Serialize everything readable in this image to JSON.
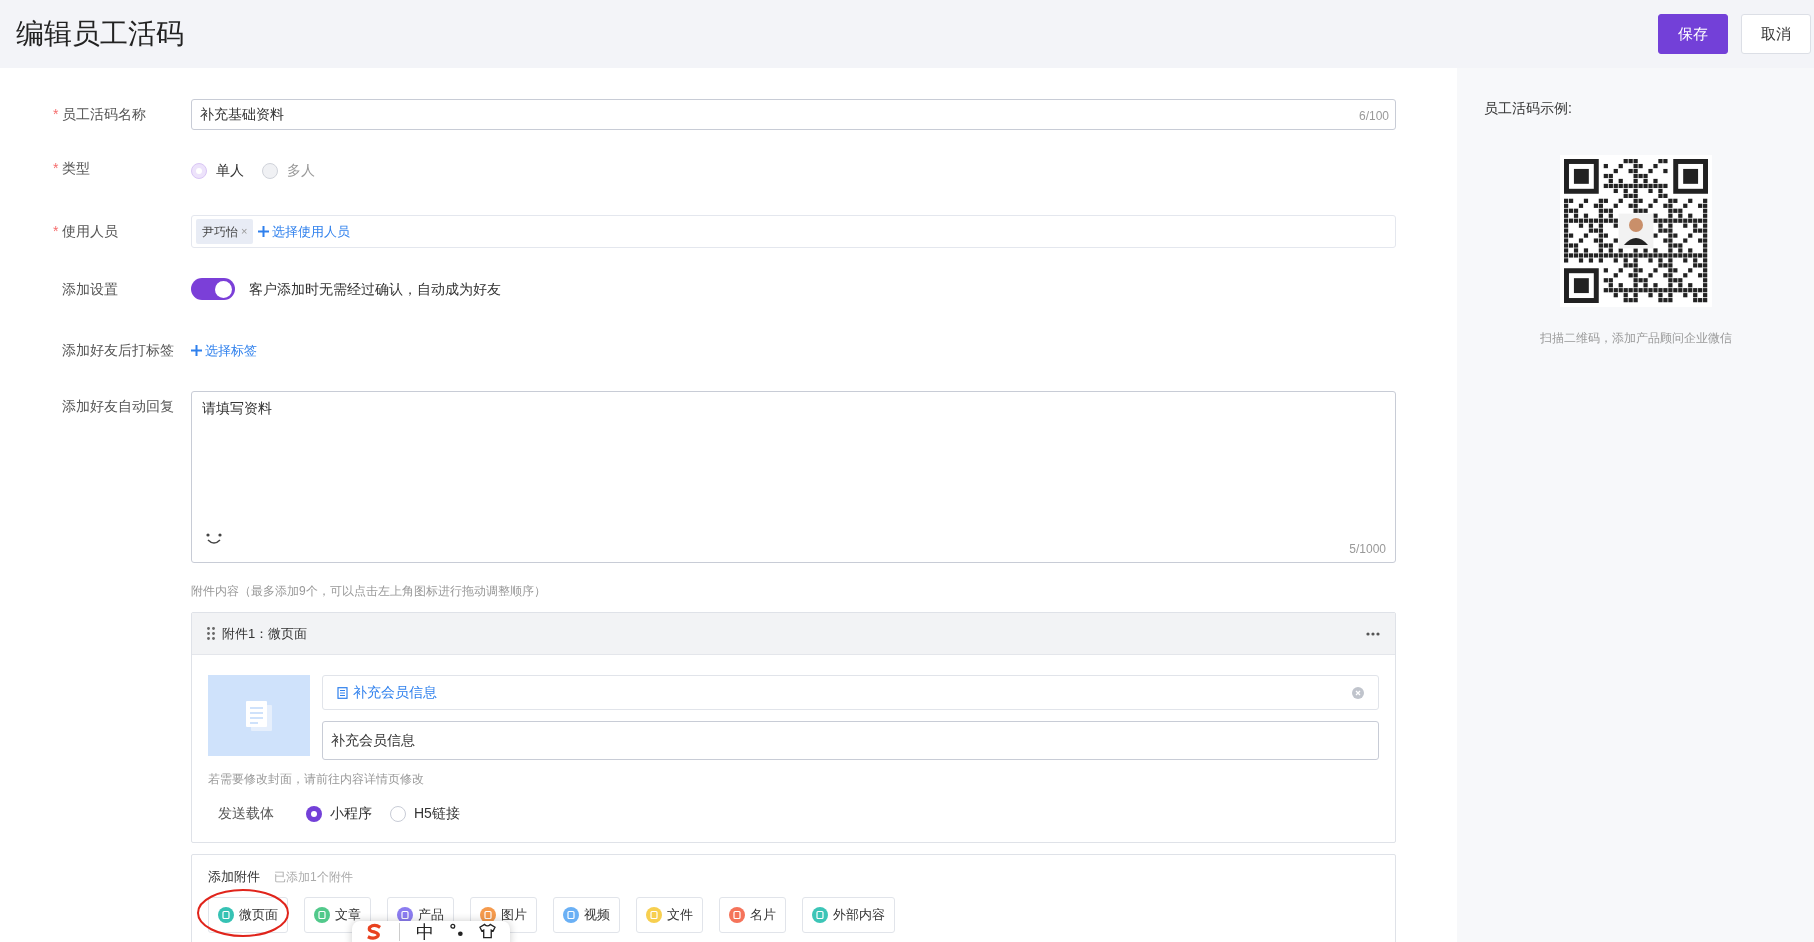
{
  "header": {
    "title": "编辑员工活码",
    "buttons": [
      {
        "label": "保存",
        "kind": "primary"
      },
      {
        "label": "取消",
        "kind": "default"
      }
    ]
  },
  "name_field": {
    "label": "员工活码名称",
    "required_mark": "*",
    "value": "补充基础资料",
    "counter": "6/100"
  },
  "type_field": {
    "label": "类型",
    "required_mark": "*",
    "disabled": true,
    "options": [
      {
        "label": "单人",
        "selected": true
      },
      {
        "label": "多人",
        "selected": false
      }
    ]
  },
  "users_field": {
    "label": "使用人员",
    "required_mark": "*",
    "tags": [
      {
        "label": "尹巧怡",
        "remove": "×"
      }
    ],
    "add_link": "选择使用人员"
  },
  "add_setting": {
    "label": "添加设置",
    "on": true,
    "text": "客户添加时无需经过确认，自动成为好友"
  },
  "tag_setting": {
    "label": "添加好友后打标签",
    "add_link": "选择标签"
  },
  "auto_reply": {
    "label": "添加好友自动回复",
    "value": "请填写资料",
    "counter": "5/1000",
    "hint": "附件内容（最多添加9个，可以点击左上角图标进行拖动调整顺序）"
  },
  "attachments": [
    {
      "title": "附件1：微页面",
      "link_title": "补充会员信息",
      "value": "补充会员信息",
      "note": "若需要修改封面，请前往内容详情页修改",
      "carrier_label": "发送载体",
      "carriers": [
        {
          "label": "小程序",
          "selected": true
        },
        {
          "label": "H5链接",
          "selected": false
        }
      ]
    }
  ],
  "add_attachment": {
    "title": "添加附件",
    "count": "已添加1个附件",
    "types": [
      {
        "label": "微页面",
        "color": "#36c2b4",
        "circled": true
      },
      {
        "label": "文章",
        "color": "#52c98b",
        "circled": false
      },
      {
        "label": "产品",
        "color": "#8b7cf0",
        "circled": false
      },
      {
        "label": "图片",
        "color": "#f59a4c",
        "circled": false
      },
      {
        "label": "视频",
        "color": "#6ab0f5",
        "circled": false
      },
      {
        "label": "文件",
        "color": "#f7cf4f",
        "circled": false
      },
      {
        "label": "名片",
        "color": "#f5735a",
        "circled": false
      },
      {
        "label": "外部内容",
        "color": "#3cc5b7",
        "circled": false
      }
    ]
  },
  "ime_toolbar": {
    "mode": "中"
  },
  "example": {
    "title": "员工活码示例:",
    "caption": "扫描二维码，添加产品顾问企业微信"
  }
}
